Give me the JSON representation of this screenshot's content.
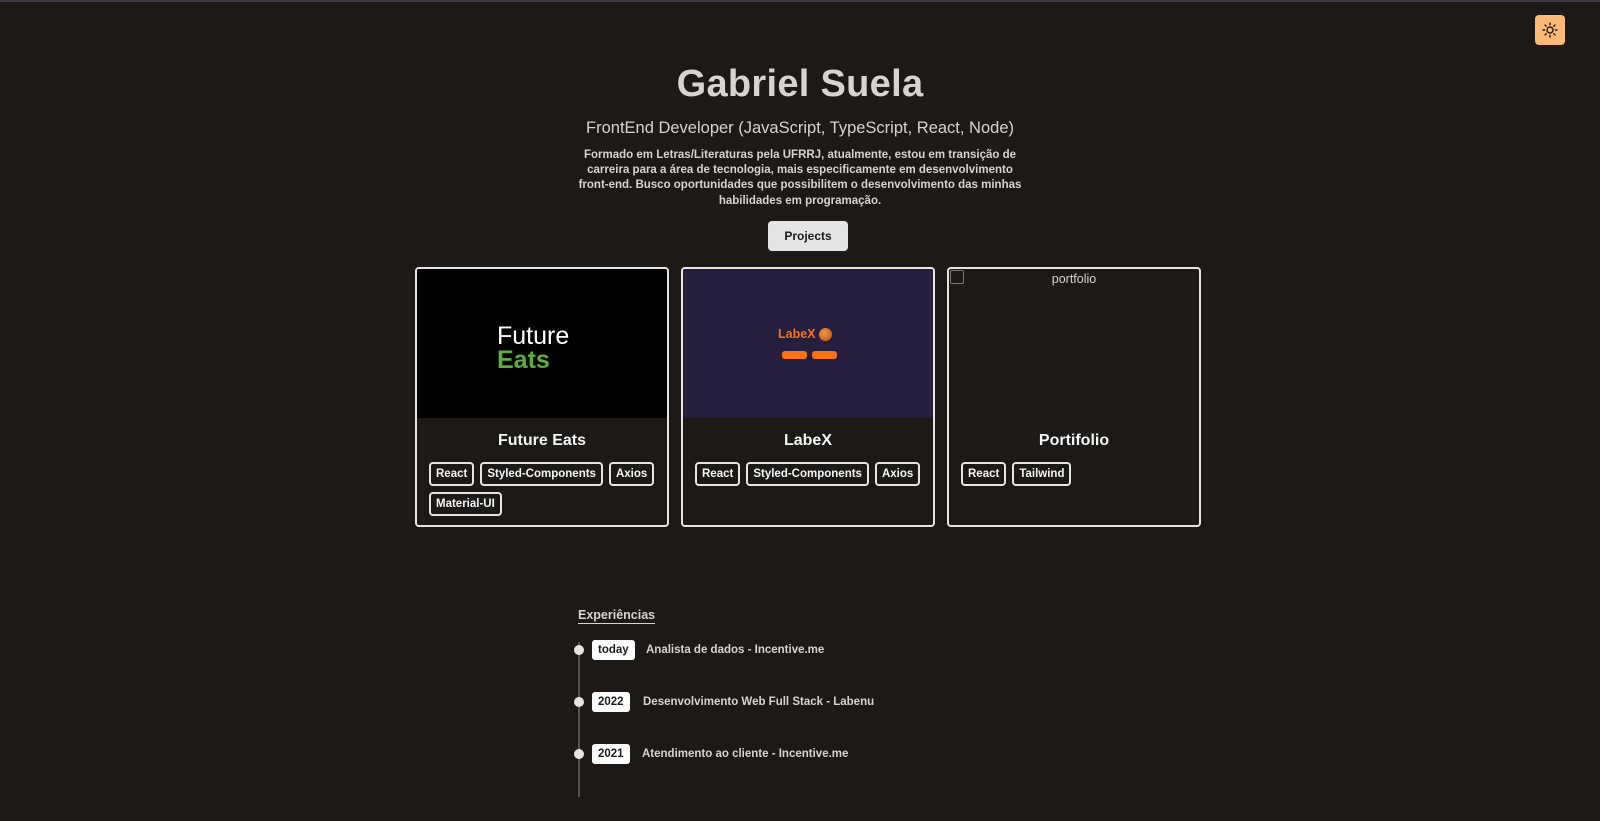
{
  "header": {
    "theme_toggle_icon": "sun-icon"
  },
  "hero": {
    "name": "Gabriel Suela",
    "subtitle": "FrontEnd Developer (JavaScript, TypeScript, React, Node)",
    "bio": "Formado em Letras/Literaturas pela UFRRJ, atualmente, estou em transição de carreira para a área de tecnologia, mais especificamente em desenvolvimento front-end. Busco oportunidades que possibilitem o desenvolvimento das minhas habilidades em programação.",
    "projects_button": "Projects"
  },
  "projects": [
    {
      "title": "Future Eats",
      "logo_line1": "Future",
      "logo_line2": "Eats",
      "tags": [
        "React",
        "Styled-Components",
        "Axios",
        "Material-UI"
      ]
    },
    {
      "title": "LabeX",
      "logo_text": "LabeX",
      "tags": [
        "React",
        "Styled-Components",
        "Axios"
      ]
    },
    {
      "title": "Portifolio",
      "image_alt": "portfolio",
      "tags": [
        "React",
        "Tailwind"
      ]
    }
  ],
  "experiences": {
    "title": "Experiências",
    "items": [
      {
        "period": "today",
        "description": "Analista de dados - Incentive.me"
      },
      {
        "period": "2022",
        "description": "Desenvolvimento Web Full Stack - Labenu"
      },
      {
        "period": "2021",
        "description": "Atendimento ao cliente - Incentive.me"
      }
    ]
  },
  "colors": {
    "background": "#1c1917",
    "accent": "#fdba74",
    "future_eats_green": "#5ead3f",
    "labex_orange": "#f97316",
    "labex_bg": "#261e3e"
  }
}
